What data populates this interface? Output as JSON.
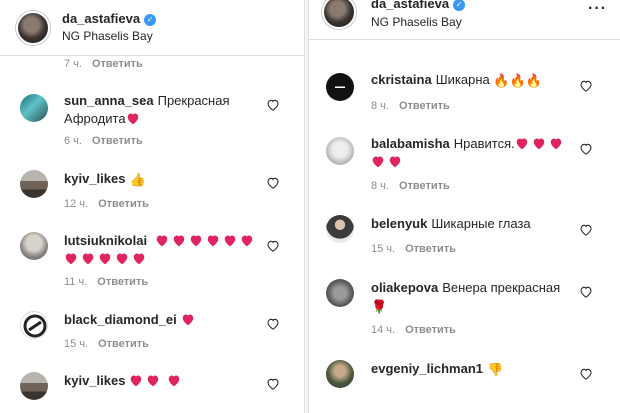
{
  "left": {
    "post_user": "da_astafieva",
    "post_location": "NG Phaselis Bay",
    "top_meta_time": "7 ч.",
    "reply_label": "Ответить",
    "comments": [
      {
        "user": "sun_anna_sea",
        "text": "Прекрасная",
        "text2": "Афродита",
        "hearts": 1,
        "time": "6 ч."
      },
      {
        "user": "kyiv_likes",
        "emoji": "👍",
        "time": "12 ч."
      },
      {
        "user": "lutsiuknikolai",
        "hearts": 6,
        "hearts2": 5,
        "time": "11 ч."
      },
      {
        "user": "black_diamond_ei",
        "hearts": 1,
        "time": "15 ч."
      },
      {
        "user": "kyiv_likes",
        "hearts": 3,
        "time": ""
      }
    ]
  },
  "right": {
    "post_user": "da_astafieva",
    "post_location": "NG Phaselis Bay",
    "reply_label": "Ответить",
    "comments": [
      {
        "user": "ckristaina",
        "text": "Шикарна",
        "emoji": "🔥🔥🔥",
        "time": "8 ч."
      },
      {
        "user": "balabamisha",
        "text": "Нравится.",
        "hearts": 3,
        "hearts2": 2,
        "time": "8 ч."
      },
      {
        "user": "belenyuk",
        "text": "Шикарные глаза",
        "time": "15 ч."
      },
      {
        "user": "oliakepova",
        "text": "Венера прекрасная",
        "emoji": "🌹",
        "time": "14 ч."
      },
      {
        "user": "evgeniy_lichman1",
        "emoji": "👎",
        "time": ""
      }
    ]
  },
  "colors": {
    "heart": "#e0245e",
    "verified": "#3897f0",
    "muted": "#8e8e8e",
    "text": "#262626"
  },
  "icons": {
    "like": "heart-outline-icon",
    "more": "more-options-icon",
    "verified": "verified-badge-icon"
  }
}
